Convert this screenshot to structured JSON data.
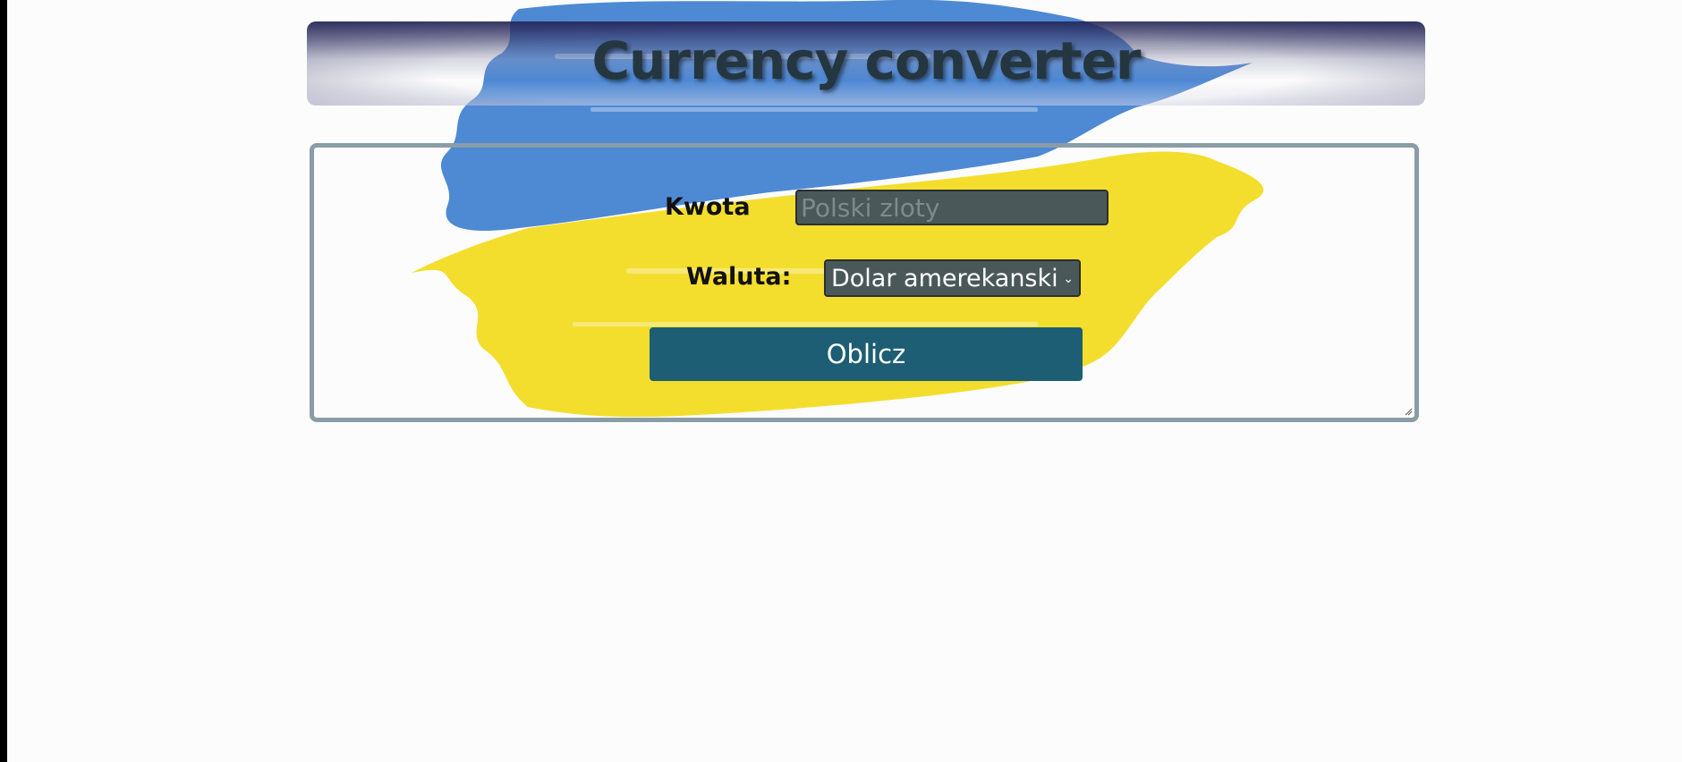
{
  "header": {
    "title": "Currency converter"
  },
  "form": {
    "amount_label": "Kwota",
    "amount_placeholder": "Polski zloty",
    "amount_value": "",
    "currency_label": "Waluta:",
    "currency_selected": "Dolar amerekanski",
    "submit_label": "Oblicz"
  },
  "colors": {
    "flag_blue": "#3f7fd0",
    "flag_yellow": "#f3dc22",
    "button": "#1d5e74",
    "field_bg": "#4a5859",
    "border": "#8a9da6"
  }
}
